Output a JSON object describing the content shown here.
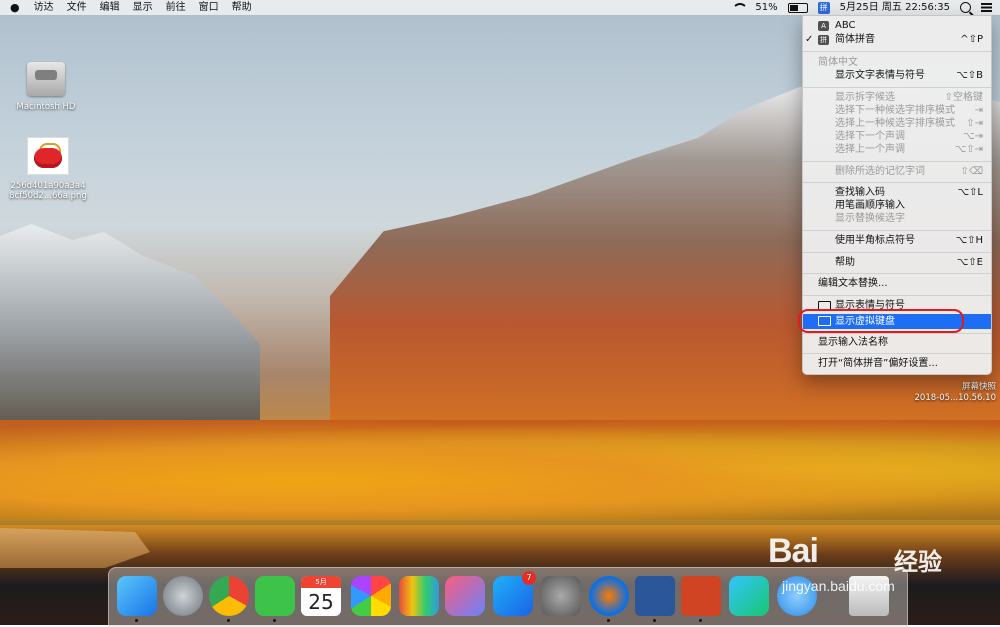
{
  "menubar": {
    "apple": "",
    "items": [
      "访达",
      "文件",
      "编辑",
      "显示",
      "前往",
      "窗口",
      "帮助"
    ],
    "battery": "51%",
    "input_source": "拼",
    "datetime": "5月25日 周五  22:56:35"
  },
  "desktop": {
    "hd_label": "Macintosh HD",
    "file_label_line1": "256d401a90a3a4",
    "file_label_line2": "8cf50d2...66a.png",
    "screenshot_line1": "屏幕快照",
    "screenshot_line2": "2018-05...10.56.10"
  },
  "dropdown": {
    "abc": "ABC",
    "pinyin": "简体拼音",
    "pinyin_shortcut": "^⇧P",
    "section_label": "简体中文",
    "show_emoji_symbols": "显示文字表情与符号",
    "show_emoji_symbols_sc": "⌥⇧B",
    "show_split": "显示拆字候选",
    "show_split_sc": "⇧空格键",
    "next_sort": "选择下一种候选字排序模式",
    "next_sort_sc": "⇥",
    "prev_sort": "选择上一种候选字排序模式",
    "prev_sort_sc": "⇧⇥",
    "next_tone": "选择下一个声调",
    "next_tone_sc": "⌥⇥",
    "prev_tone": "选择上一个声调",
    "prev_tone_sc": "⌥⇧⇥",
    "delete_memorized": "删除所选的记忆字词",
    "delete_memorized_sc": "⇧⌫",
    "lookup_code": "查找输入码",
    "lookup_code_sc": "⌥⇧L",
    "stroke_input": "用笔画顺序输入",
    "show_alternates": "显示替换候选字",
    "half_width_punct": "使用半角标点符号",
    "half_width_punct_sc": "⌥⇧H",
    "help": "帮助",
    "help_sc": "⌥⇧E",
    "edit_text_replace": "编辑文本替换...",
    "show_emoji_viewer": "显示表情与符号",
    "show_virtual_keyboard": "显示虚拟键盘",
    "show_input_name": "显示输入法名称",
    "open_prefs": "打开“简体拼音”偏好设置..."
  },
  "dock": {
    "calendar_month": "5月",
    "calendar_day": "25",
    "appstore_badge": "7"
  },
  "watermark": {
    "logo": "Bai  ",
    "cn": "经验",
    "url": "jingyan.baidu.com"
  },
  "colors": {
    "highlight": "#1d6ef4",
    "annotation_ring": "#e31b1b"
  }
}
